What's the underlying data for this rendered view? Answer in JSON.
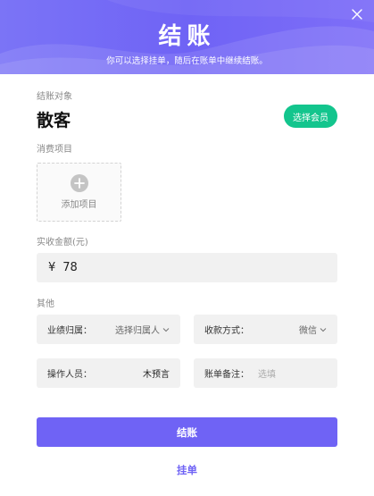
{
  "header": {
    "title": "结账",
    "subtitle": "你可以选择挂单，随后在账单中继续结账。"
  },
  "target": {
    "label": "结账对象",
    "customer": "散客",
    "select_member_label": "选择会员"
  },
  "items": {
    "label": "消费项目",
    "add_label": "添加项目"
  },
  "amount": {
    "label": "实收金额(元)",
    "currency": "¥",
    "value": "78"
  },
  "other": {
    "label": "其他",
    "performance": {
      "key": "业绩归属：",
      "value": "选择归属人"
    },
    "payment": {
      "key": "收款方式：",
      "value": "微信"
    },
    "operator": {
      "key": "操作人员：",
      "value": "木预言"
    },
    "remark": {
      "key": "账单备注：",
      "placeholder": "选填"
    }
  },
  "actions": {
    "checkout_label": "结账",
    "hang_label": "挂单"
  },
  "colors": {
    "accent": "#6f63f5",
    "member_green": "#13c58d"
  }
}
